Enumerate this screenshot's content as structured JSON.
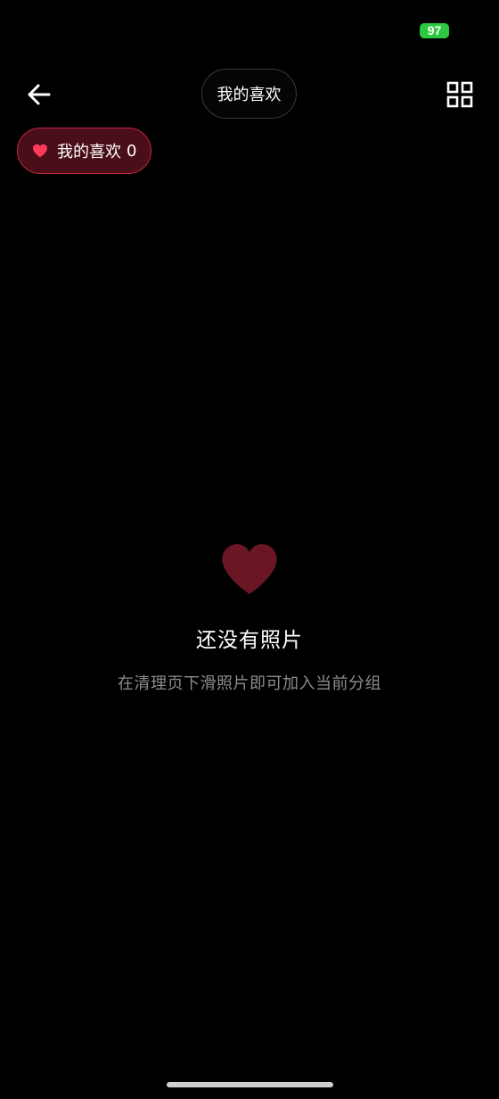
{
  "status_bar": {
    "battery_level": "97",
    "battery_color": "#2dc841"
  },
  "header": {
    "back_icon": "arrow-left-icon",
    "title": "我的喜欢",
    "grid_icon": "grid-view-icon"
  },
  "album_chip": {
    "icon": "heart-icon",
    "label": "我的喜欢",
    "count": "0",
    "accent_color": "#ff3b5c"
  },
  "empty_state": {
    "icon": "heart-icon",
    "title": "还没有照片",
    "subtitle": "在清理页下滑照片即可加入当前分组",
    "icon_color": "#6b1624"
  }
}
